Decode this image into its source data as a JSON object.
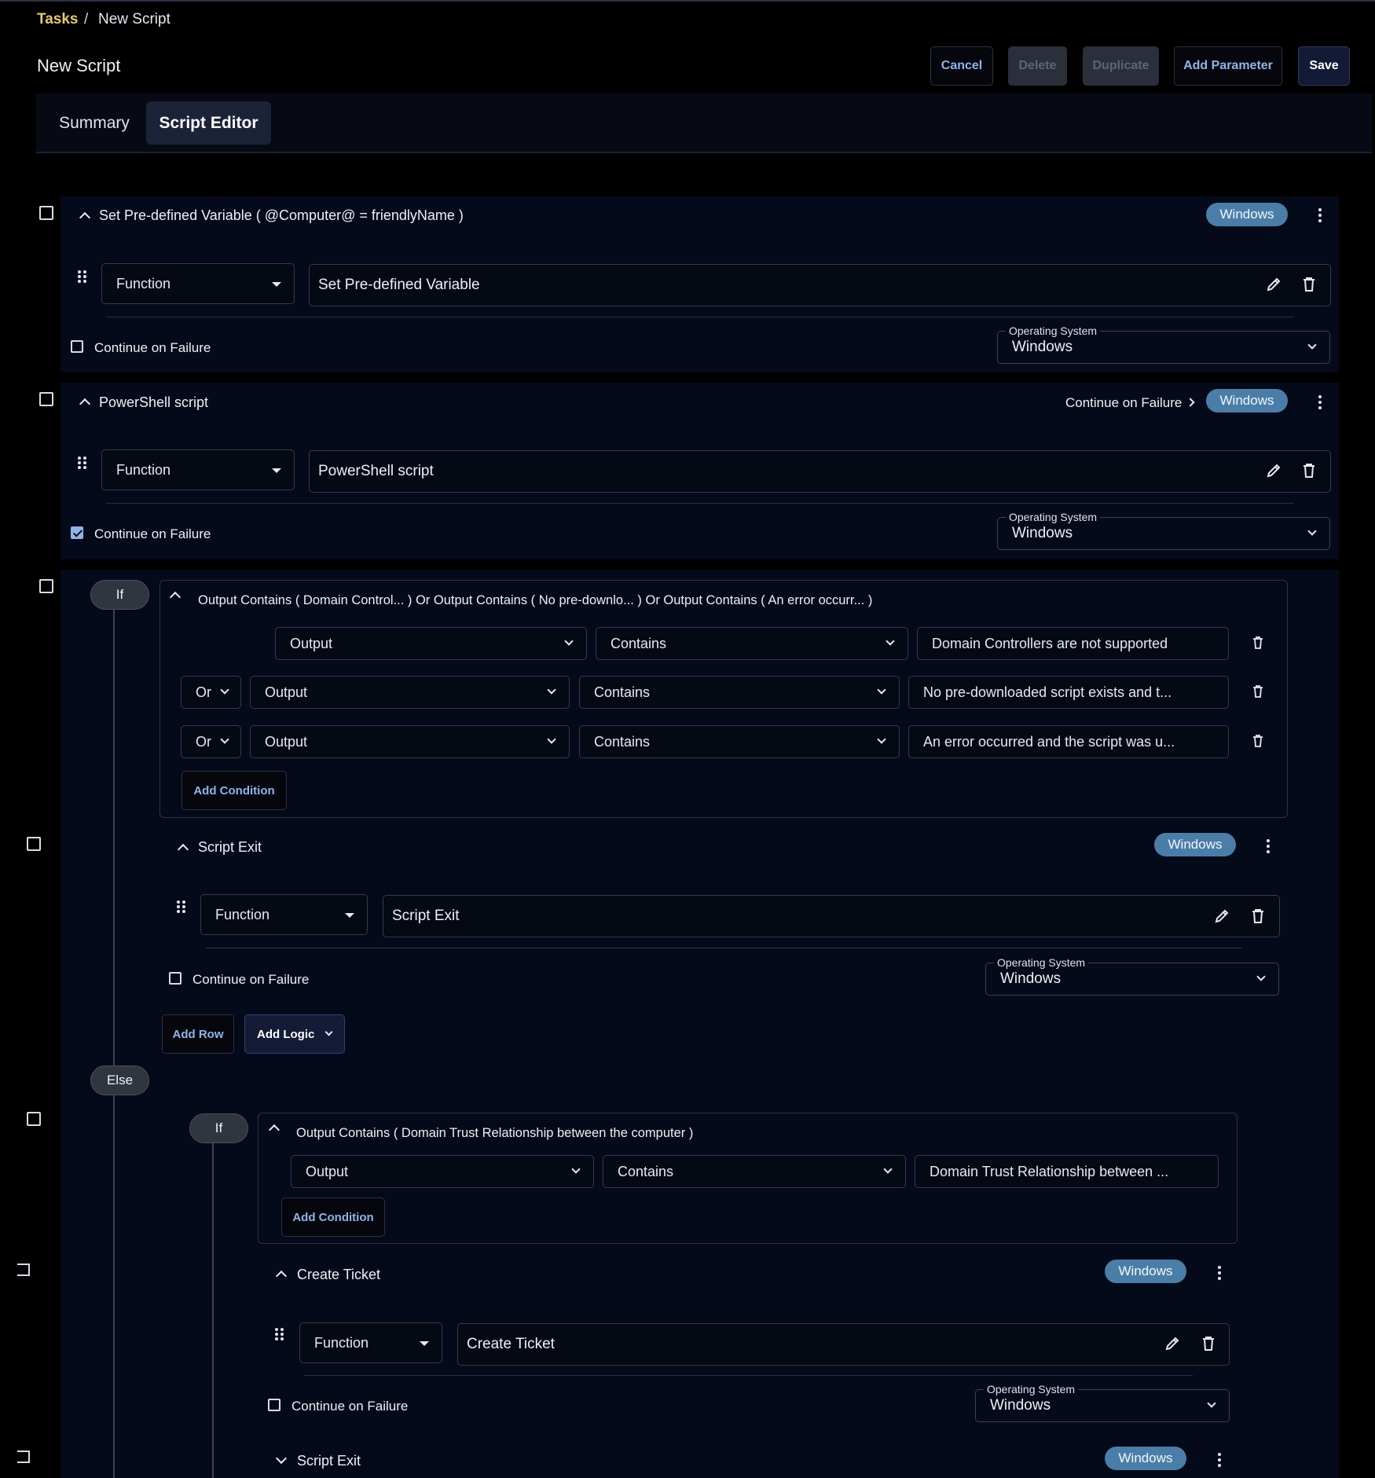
{
  "breadcrumb": {
    "root": "Tasks",
    "separator": "/",
    "current": "New Script"
  },
  "page_title": "New Script",
  "header_buttons": {
    "cancel": "Cancel",
    "delete": "Delete",
    "duplicate": "Duplicate",
    "add_parameter": "Add Parameter",
    "save": "Save"
  },
  "tabs": {
    "summary": "Summary",
    "script_editor": "Script Editor",
    "active": "Script Editor"
  },
  "colors": {
    "accent_link": "#8fb4ea",
    "breadcrumb_link": "#e8c96a",
    "badge": "#4a7ea8",
    "panel": "#050a1a"
  },
  "rows": {
    "set_variable": {
      "title": "Set Pre-defined Variable ( @Computer@ = friendlyName )",
      "badge": "Windows",
      "type_select": "Function",
      "function_value": "Set Pre-defined Variable",
      "continue_label": "Continue on Failure",
      "continue_checked": false,
      "os_legend": "Operating System",
      "os_value": "Windows"
    },
    "powershell": {
      "title": "PowerShell script",
      "header_status": "Continue on Failure",
      "badge": "Windows",
      "type_select": "Function",
      "function_value": "PowerShell script",
      "continue_label": "Continue on Failure",
      "continue_checked": true,
      "os_legend": "Operating System",
      "os_value": "Windows"
    }
  },
  "if_block": {
    "if_label": "If",
    "summary": "Output Contains ( Domain Control... ) Or Output Contains ( No pre-downlo...  ) Or Output Contains ( An error occurr...  )",
    "conditions": [
      {
        "operator": "",
        "field": "Output",
        "comparison": "Contains",
        "value": "Domain Controllers are not supported"
      },
      {
        "operator": "Or",
        "field": "Output",
        "comparison": "Contains",
        "value": "No pre-downloaded script exists and t..."
      },
      {
        "operator": "Or",
        "field": "Output",
        "comparison": "Contains",
        "value": "An error occurred and the script was u..."
      }
    ],
    "add_condition": "Add Condition",
    "script_exit": {
      "title": "Script Exit",
      "badge": "Windows",
      "type_select": "Function",
      "function_value": "Script Exit",
      "continue_label": "Continue on Failure",
      "os_legend": "Operating System",
      "os_value": "Windows"
    },
    "add_row": "Add Row",
    "add_logic": "Add Logic",
    "else_label": "Else"
  },
  "nested_if": {
    "if_label": "If",
    "summary": "Output Contains ( Domain Trust Relationship between the computer )",
    "condition": {
      "field": "Output",
      "comparison": "Contains",
      "value": "Domain Trust Relationship between ..."
    },
    "add_condition": "Add Condition",
    "create_ticket": {
      "title": "Create Ticket",
      "badge": "Windows",
      "type_select": "Function",
      "function_value": "Create Ticket",
      "continue_label": "Continue on Failure",
      "os_legend": "Operating System",
      "os_value": "Windows"
    },
    "script_exit_collapsed": {
      "title": "Script Exit",
      "badge": "Windows"
    }
  },
  "icons": [
    "checkbox-icon",
    "chevron-up-icon",
    "chevron-down-icon",
    "kebab-menu-icon",
    "drag-handle-icon",
    "pencil-icon",
    "trash-icon",
    "caret-down-icon",
    "chevron-right-icon"
  ]
}
